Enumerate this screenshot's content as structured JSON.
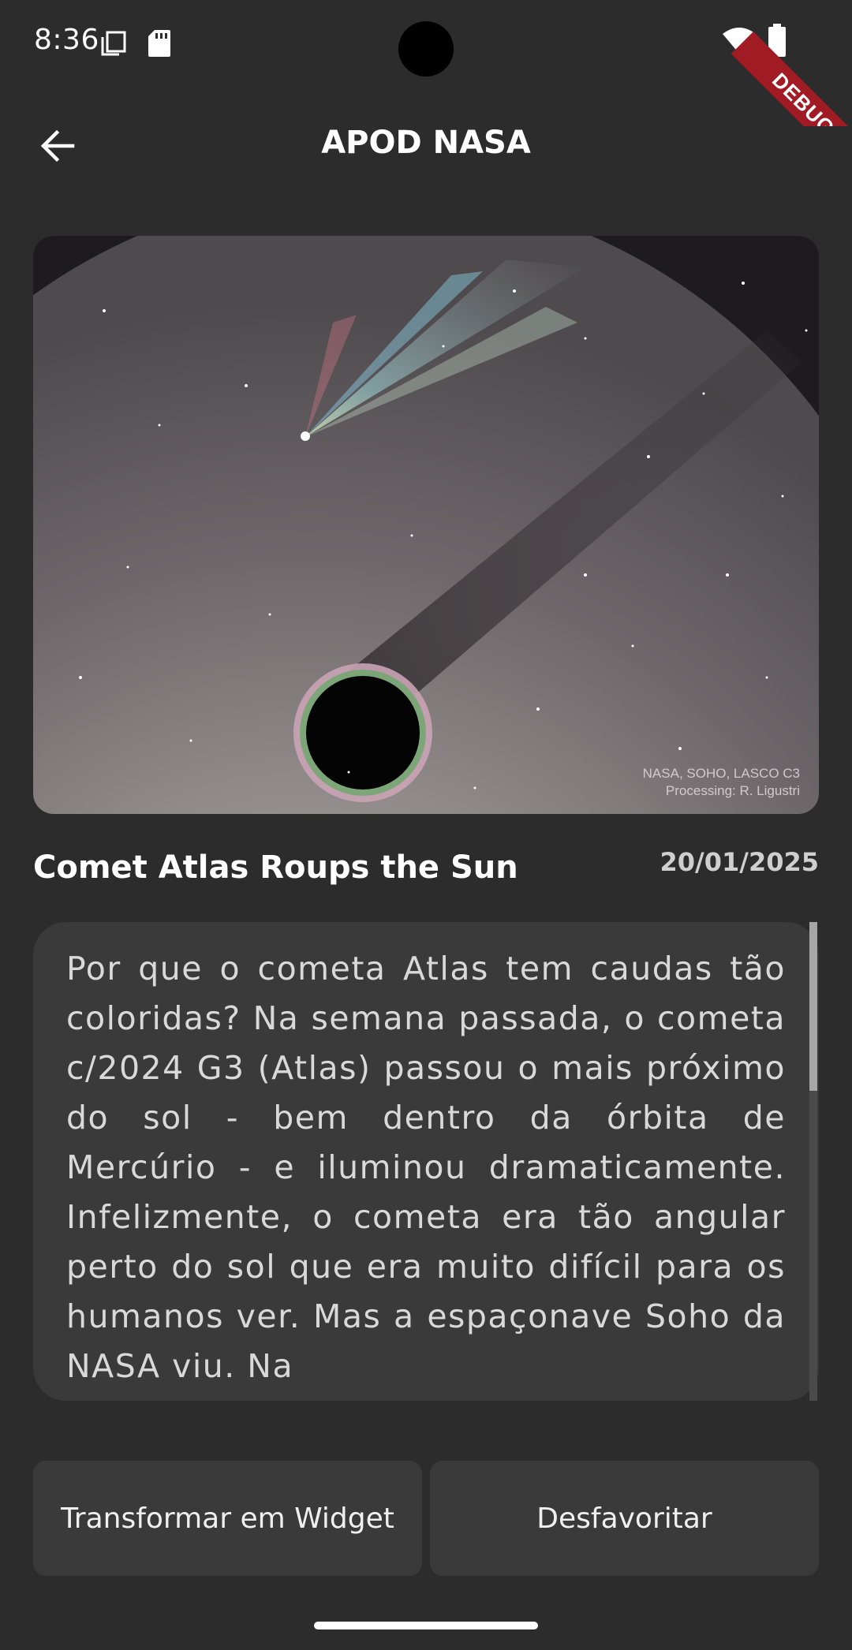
{
  "status_bar": {
    "time": "8:36",
    "icons": [
      "copy-icon",
      "sd-card-icon",
      "wifi-icon",
      "battery-icon"
    ]
  },
  "debug_banner": {
    "label": "DEBUG",
    "color": "#a11b25"
  },
  "app_bar": {
    "back_icon": "arrow-left-icon",
    "title": "APOD NASA"
  },
  "apod": {
    "image_credit_line1": "NASA, SOHO, LASCO C3",
    "image_credit_line2": "Processing: R. Ligustri",
    "title": "Comet Atlas Roups the Sun",
    "date": "20/01/2025",
    "explanation": "Por que o cometa Atlas tem caudas tão coloridas? Na semana passada, o cometa c/2024 G3 (Atlas) passou o mais próximo do sol - bem dentro da órbita de Mercúrio - e iluminou dramaticamente. Infelizmente, o cometa era tão angular perto do sol que era muito difícil para os humanos ver. Mas a espaçonave Soho da NASA viu. Na"
  },
  "actions": {
    "widget_label": "Transformar em Widget",
    "unfavorite_label": "Desfavoritar"
  },
  "colors": {
    "background": "#2c2c2c",
    "surface": "#3a3a3a",
    "text_primary": "#ffffff",
    "text_secondary": "#d9d9d9"
  }
}
